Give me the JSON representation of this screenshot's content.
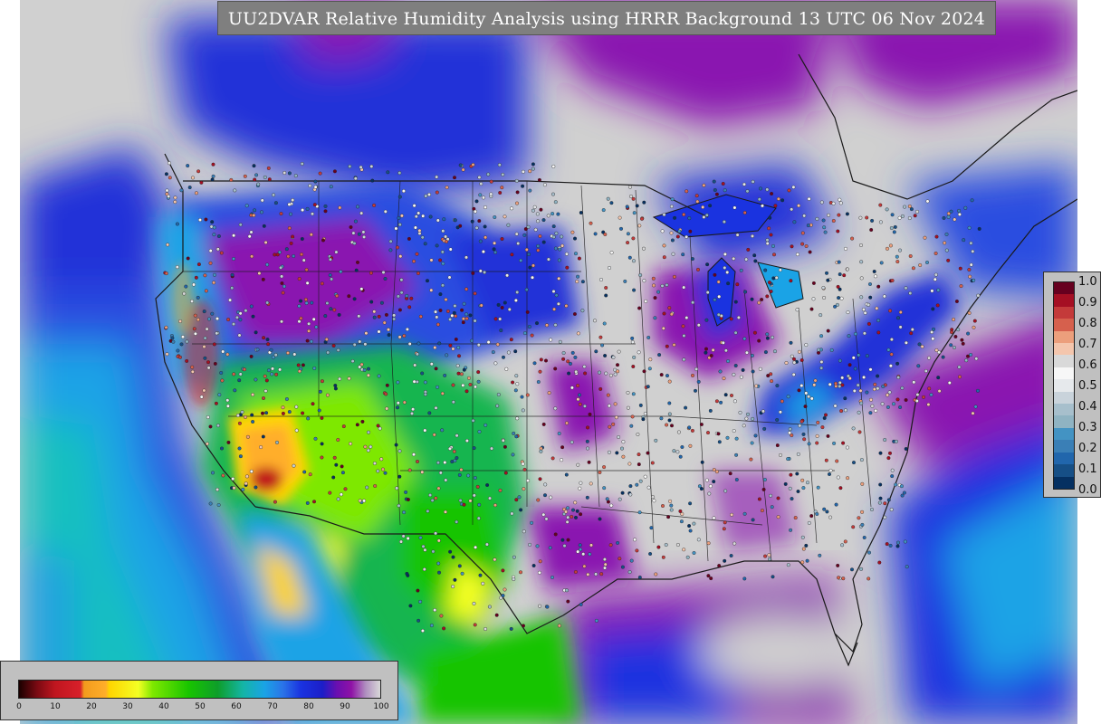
{
  "title": "UU2DVAR Relative Humidity Analysis using HRRR Background 13 UTC 06 Nov 2024",
  "observation_colorbar": {
    "ticks": [
      "1.0",
      "0.9",
      "0.8",
      "0.7",
      "0.6",
      "0.5",
      "0.4",
      "0.3",
      "0.2",
      "0.1",
      "0.0"
    ],
    "colors": [
      "#67001f",
      "#a50f23",
      "#c43a3a",
      "#d6604d",
      "#ec9f7c",
      "#f4c6ad",
      "#d9d9d9",
      "#f7f7f7",
      "#e6e9ec",
      "#c9d3db",
      "#a7bfcc",
      "#8fb3c2",
      "#4393c3",
      "#3a7fb6",
      "#2166ac",
      "#164f86",
      "#053061"
    ]
  },
  "rh_colorbar": {
    "ticks": [
      "0",
      "10",
      "20",
      "30",
      "40",
      "50",
      "60",
      "70",
      "80",
      "90",
      "100"
    ],
    "stops": [
      {
        "value": 0,
        "color": "#1a0000"
      },
      {
        "value": 5,
        "color": "#7a0a12"
      },
      {
        "value": 10,
        "color": "#c0161f"
      },
      {
        "value": 17,
        "color": "#d8202a"
      },
      {
        "value": 18,
        "color": "#f29b1d"
      },
      {
        "value": 24,
        "color": "#ffae2a"
      },
      {
        "value": 25,
        "color": "#ffd400"
      },
      {
        "value": 33,
        "color": "#f4ff24"
      },
      {
        "value": 37,
        "color": "#7ee800"
      },
      {
        "value": 47,
        "color": "#18c400"
      },
      {
        "value": 55,
        "color": "#0e9e2a"
      },
      {
        "value": 62,
        "color": "#14b5a6"
      },
      {
        "value": 68,
        "color": "#1aa3e6"
      },
      {
        "value": 73,
        "color": "#2a74e8"
      },
      {
        "value": 78,
        "color": "#1a33e0"
      },
      {
        "value": 84,
        "color": "#1c1ec8"
      },
      {
        "value": 88,
        "color": "#6a0fb0"
      },
      {
        "value": 92,
        "color": "#8f12a6"
      },
      {
        "value": 96,
        "color": "#b090c0"
      },
      {
        "value": 100,
        "color": "#d8d8d8"
      }
    ]
  },
  "map": {
    "ocean_color": "#1a6ee8",
    "saturated_color": "#d0d0d0",
    "moist_color": "#8a12b0",
    "dry_color": "#ffb21e",
    "border_color": "#1a1a1a"
  }
}
